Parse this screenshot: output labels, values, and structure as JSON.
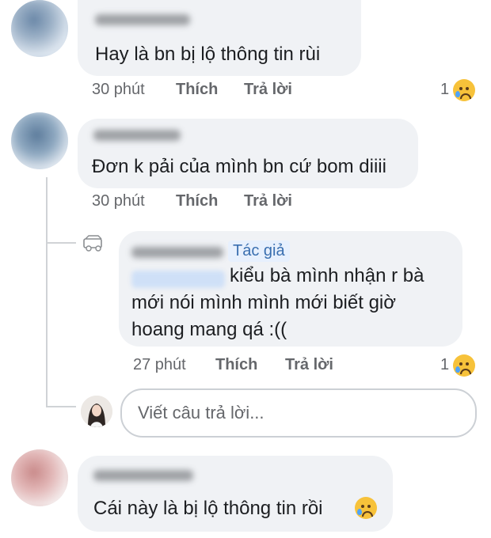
{
  "comments": [
    {
      "text": "Hay là bn bị lộ thông tin rùi",
      "time": "30 phút",
      "like": "Thích",
      "reply": "Trả lời",
      "reaction_count": "1",
      "reaction_icon": "crying-face-icon"
    },
    {
      "text": "Đơn k pải của mình bn cứ bom diiii",
      "time": "30 phút",
      "like": "Thích",
      "reply": "Trả lời"
    },
    {
      "text": "Cái này là bị lộ thông tin rồi",
      "text_emoji": "😢"
    }
  ],
  "reply": {
    "badge": "Tác giả",
    "text_line1": "kiểu bà mình nhận r bà",
    "text_line2": "mới nói mình mình mới biết giờ",
    "text_line3": "hoang mang qá :((",
    "time": "27 phút",
    "like": "Thích",
    "reply": "Trả lời",
    "reaction_count": "1",
    "reaction_icon": "crying-face-icon"
  },
  "reply_input": {
    "placeholder": "Viết câu trả lời..."
  },
  "colors": {
    "bubble": "#f0f2f5",
    "meta_text": "#65676b",
    "author_badge": "#e7f0fd"
  }
}
